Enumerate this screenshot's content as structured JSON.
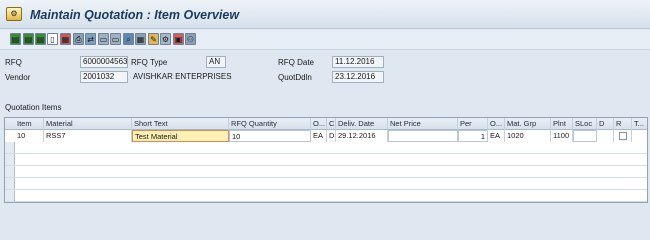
{
  "title": {
    "icon": "settings-icon",
    "text": "Maintain Quotation : Item Overview"
  },
  "toolbar": {
    "buttons": [
      {
        "icon": "item-overview-icon",
        "glyph": "▤",
        "color": "#3a8a3a"
      },
      {
        "icon": "item-detail-icon",
        "glyph": "▤",
        "color": "#3a8a3a"
      },
      {
        "icon": "header-icon",
        "glyph": "▤",
        "color": "#3a8a3a"
      },
      {
        "icon": "document-icon",
        "glyph": "▯",
        "color": "#ffffff"
      },
      {
        "icon": "delete-icon",
        "glyph": "▦",
        "color": "#c75a5a"
      },
      {
        "icon": "print-icon",
        "glyph": "⎙",
        "color": "#8aa0b5"
      },
      {
        "icon": "text-icon",
        "glyph": "⇄",
        "color": "#7f9fbf"
      },
      {
        "icon": "attach-icon",
        "glyph": "▭",
        "color": "#9fb0c3"
      },
      {
        "icon": "sort-icon",
        "glyph": "▭",
        "color": "#9fb0c3"
      },
      {
        "icon": "search-icon",
        "glyph": "⌕",
        "color": "#5f87b0"
      },
      {
        "icon": "calculate-icon",
        "glyph": "▦",
        "color": "#8aa0b5"
      },
      {
        "icon": "edit-icon",
        "glyph": "✎",
        "color": "#e0b65a"
      },
      {
        "icon": "settings-icon",
        "glyph": "⚙",
        "color": "#a8b8c8"
      },
      {
        "icon": "copy-icon",
        "glyph": "▣",
        "color": "#d06060"
      },
      {
        "icon": "network-icon",
        "glyph": "⚇",
        "color": "#8aa0b5"
      }
    ]
  },
  "header": {
    "rfq_label": "RFQ",
    "rfq_value": "6000004563",
    "rfq_type_label": "RFQ Type",
    "rfq_type_value": "AN",
    "rfq_date_label": "RFQ Date",
    "rfq_date_value": "11.12.2016",
    "vendor_label": "Vendor",
    "vendor_value": "2001032",
    "vendor_name": "AVISHKAR ENTERPRISES",
    "quotddln_label": "QuotDdln",
    "quotddln_value": "23.12.2016"
  },
  "table": {
    "title": "Quotation Items",
    "columns": [
      "Item",
      "Material",
      "Short Text",
      "RFQ Quantity",
      "O...",
      "C",
      "Deliv. Date",
      "Net Price",
      "Per",
      "O...",
      "Mat. Grp",
      "Plnt",
      "SLoc",
      "D",
      "R",
      "T..."
    ],
    "rows": [
      {
        "item": "10",
        "material": "RSS7",
        "short_text": "Test Material",
        "rfq_quantity": "10",
        "order_unit": "EA",
        "cat": "D",
        "deliv_date": "29.12.2016",
        "net_price": "",
        "per": "1",
        "price_unit": "EA",
        "mat_grp": "1020",
        "plnt": "1100",
        "sloc": "",
        "d": "",
        "r": "",
        "t": ""
      }
    ]
  }
}
